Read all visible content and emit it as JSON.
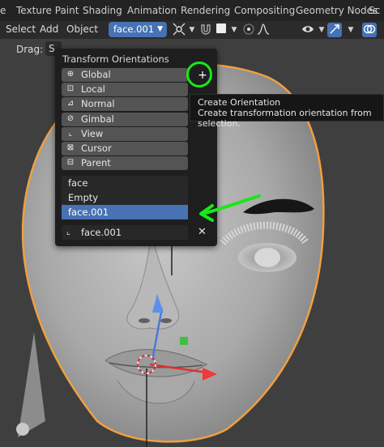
{
  "tabs": {
    "edge": "e",
    "items": [
      "Texture Paint",
      "Shading",
      "Animation",
      "Rendering",
      "Compositing",
      "Geometry Nodes",
      "Sc"
    ]
  },
  "header": {
    "menus": [
      "Select",
      "Add",
      "Object"
    ],
    "orientation_value": "face.001"
  },
  "viewport": {
    "drag_label": "Drag:",
    "drag_value": "S"
  },
  "popover": {
    "title": "Transform Orientations",
    "orientations": [
      {
        "label": "Global",
        "icon": "global-orientation-icon"
      },
      {
        "label": "Local",
        "icon": "local-orientation-icon"
      },
      {
        "label": "Normal",
        "icon": "normal-orientation-icon"
      },
      {
        "label": "Gimbal",
        "icon": "gimbal-orientation-icon"
      },
      {
        "label": "View",
        "icon": "view-orientation-icon"
      },
      {
        "label": "Cursor",
        "icon": "cursor-orientation-icon"
      },
      {
        "label": "Parent",
        "icon": "parent-orientation-icon"
      }
    ],
    "custom_orientations": [
      "face",
      "Empty",
      "face.001"
    ],
    "selected_custom": "face.001",
    "name_field_value": "face.001",
    "create_button": "+",
    "delete_button": "✕"
  },
  "tooltip": {
    "title": "Create Orientation",
    "description": "Create transformation orientation from selection."
  },
  "colors": {
    "accent": "#4772b3",
    "annotation_green": "#18e818",
    "skin": "#a9a9a9",
    "outline": "#f0a040"
  }
}
